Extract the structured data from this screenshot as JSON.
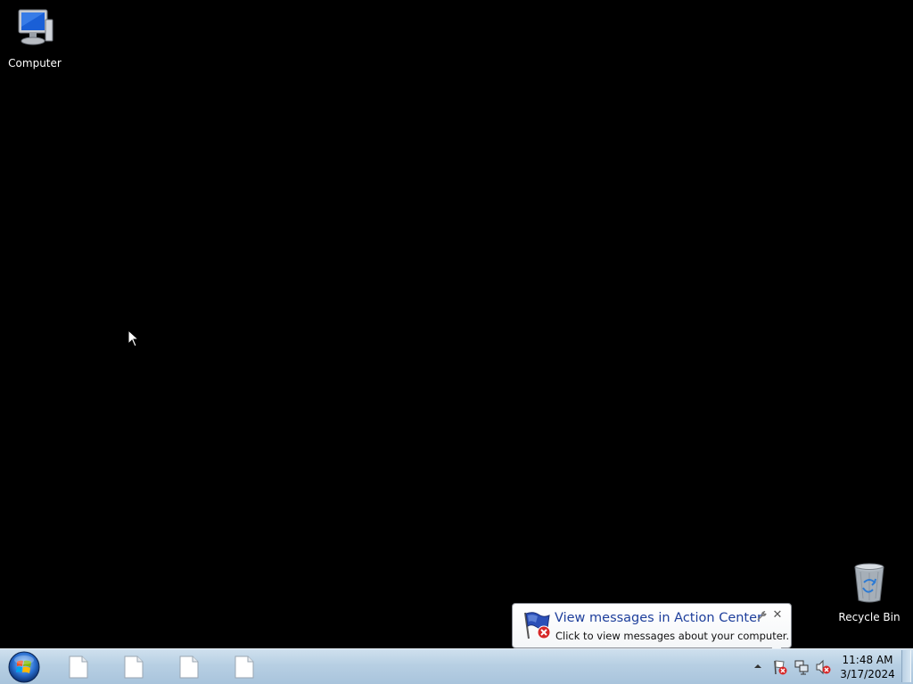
{
  "desktop": {
    "background": "#000000",
    "icons": [
      {
        "label": "Computer",
        "icon": "computer-icon"
      },
      {
        "label": "Recycle Bin",
        "icon": "recycle-bin-icon"
      }
    ]
  },
  "notification": {
    "title": "View messages in Action Center",
    "body": "Click to view messages about your computer.",
    "icon": "action-center-flag-icon",
    "title_color": "#1e3f9c"
  },
  "taskbar": {
    "start_icon": "windows-start-orb-icon",
    "buttons": [
      {
        "icon": "document-icon"
      },
      {
        "icon": "document-icon"
      },
      {
        "icon": "document-icon"
      },
      {
        "icon": "document-icon"
      }
    ],
    "tray": {
      "icons": [
        "show-hidden-icons-arrow",
        "action-center-flag-icon",
        "network-icon",
        "volume-muted-icon"
      ]
    },
    "clock": {
      "time": "11:48 AM",
      "date": "3/17/2024"
    }
  }
}
